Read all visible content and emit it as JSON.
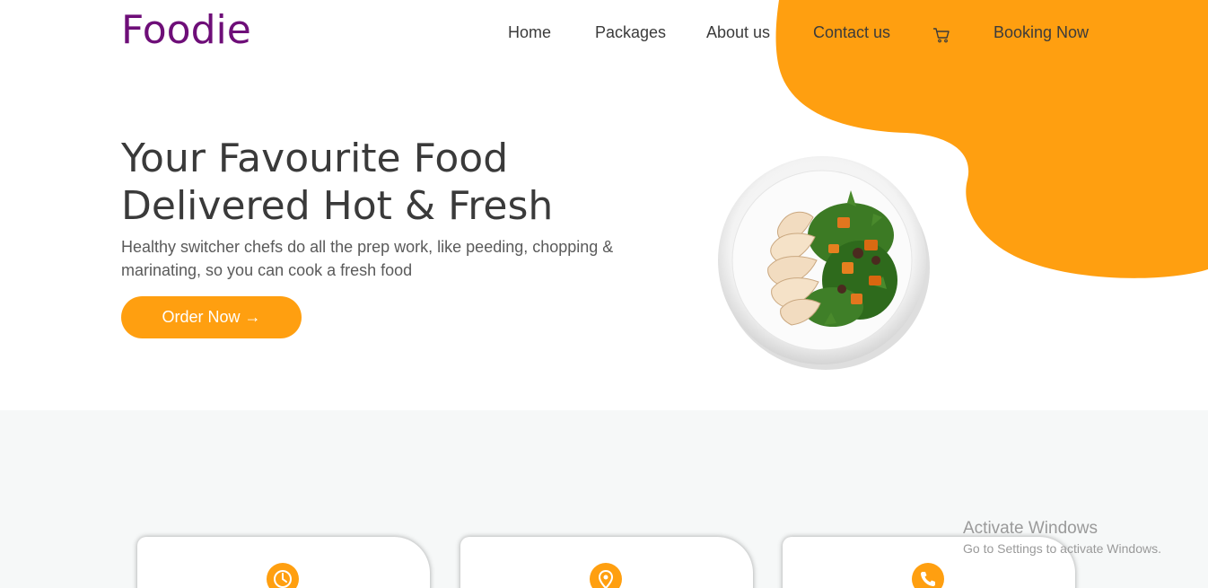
{
  "brand": {
    "logo": "Foodie",
    "logo_color": "#6e0e78",
    "accent": "#ff9f10"
  },
  "nav": {
    "home": "Home",
    "packages": "Packages",
    "about": "About us",
    "contact": "Contact us",
    "cart_icon": "cart-icon",
    "booking": "Booking Now"
  },
  "hero": {
    "title_line1": "Your Favourite Food",
    "title_line2": "Delivered Hot & Fresh",
    "subtitle": "Healthy switcher chefs do all the prep work, like peeding, chopping & marinating, so you can cook a fresh food",
    "cta": "Order Now →",
    "image": "chicken-salad-plate"
  },
  "features": {
    "cards": [
      {
        "icon": "clock-icon"
      },
      {
        "icon": "location-pin-icon"
      },
      {
        "icon": "phone-icon"
      }
    ]
  },
  "watermark": {
    "line1": "Activate Windows",
    "line2": "Go to Settings to activate Windows."
  }
}
